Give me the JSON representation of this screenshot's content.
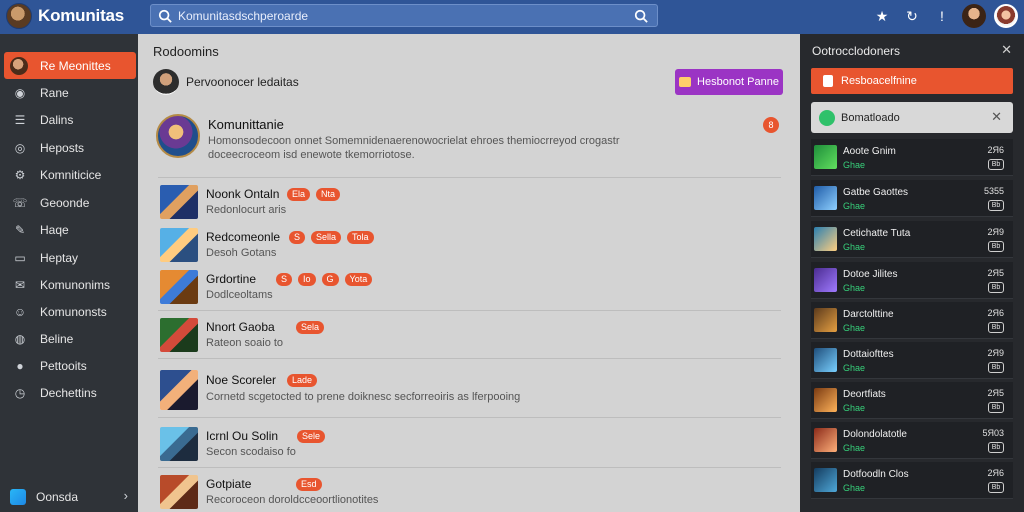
{
  "app": {
    "brand": "Komunitas",
    "accent": "#e8552f",
    "topbar_color": "#2f5597"
  },
  "search": {
    "placeholder": "Komunitasdschperoarde"
  },
  "top_icons": [
    "star-icon",
    "refresh-icon",
    "alert-icon",
    "user-avatar",
    "user-avatar"
  ],
  "sidebar": {
    "items": [
      {
        "label": "Re Meonittes",
        "icon": "avatar-icon",
        "active": true
      },
      {
        "label": "Rane",
        "icon": "compass-icon"
      },
      {
        "label": "Dalins",
        "icon": "list-icon"
      },
      {
        "label": "Heposts",
        "icon": "target-icon"
      },
      {
        "label": "Komniticice",
        "icon": "gear-icon"
      },
      {
        "label": "Geoonde",
        "icon": "phone-icon"
      },
      {
        "label": "Haqe",
        "icon": "pin-icon"
      },
      {
        "label": "Heptay",
        "icon": "window-icon"
      },
      {
        "label": "Komunonims",
        "icon": "mail-icon"
      },
      {
        "label": "Komunonsts",
        "icon": "people-icon"
      },
      {
        "label": "Beline",
        "icon": "globe-icon"
      },
      {
        "label": "Pettooits",
        "icon": "circle-icon"
      },
      {
        "label": "Dechettins",
        "icon": "clock-icon"
      }
    ],
    "footer": {
      "label": "Oonsda",
      "icon": "app-icon"
    }
  },
  "main": {
    "title": "Rodoomins",
    "user": {
      "name": "Pervoonocer ledaitas"
    },
    "action_button": "Hesbonot Panne",
    "community": {
      "name": "Komunittanie",
      "description": "Homonsodecoon onnet Somemnidenaerenowocrielat ehroes themiocrreyod crogastr doceecroceom isd enewote tkemorriotose.",
      "badge": "8"
    },
    "posts": [
      {
        "title": "Noonk Ontaln",
        "subtitle": "Redonlocurt aris",
        "tags": [
          "Ela",
          "Nta"
        ],
        "thumb": "t1"
      },
      {
        "title": "Redcomeonle",
        "subtitle": "Desoh Gotans",
        "tags": [
          "S",
          "Sella",
          "Tola"
        ],
        "thumb": "t2"
      },
      {
        "title": "Grdortine",
        "subtitle": "Dodlceoltams",
        "tags": [
          "S",
          "Io",
          "G",
          "Yota"
        ],
        "thumb": "t3"
      },
      {
        "title": "Nnort Gaoba",
        "subtitle": "Rateon soaio to",
        "tags": [
          "Sela"
        ],
        "thumb": "t4"
      },
      {
        "title": "Noe Scoreler",
        "subtitle": "Cornetd scgetocted to prene doiknesc secforreoiris as lferpooing",
        "tags": [
          "Lade"
        ],
        "thumb": "t5"
      },
      {
        "title": "Icrnl Ou Solin",
        "subtitle": "Secon scodaiso fo",
        "tags": [
          "Sele"
        ],
        "thumb": "t6"
      },
      {
        "title": "Gotpiate",
        "subtitle": "Recoroceon doroldcceoortlionotites",
        "tags": [
          "Esd"
        ],
        "thumb": "t7"
      }
    ]
  },
  "right_panel": {
    "title": "Ootrocclodoners",
    "primary_button": "Resboacelfnine",
    "notice": "Bomatloado",
    "items": [
      {
        "name": "Aoote Gnim",
        "stat": "Ghae",
        "num": "2Я6",
        "badge": "Bb",
        "thumb": "rt1"
      },
      {
        "name": "Gatbe Gaottes",
        "stat": "Ghae",
        "num": "5355",
        "badge": "Bb",
        "thumb": "rt2"
      },
      {
        "name": "Cetichatte Tuta",
        "stat": "Ghae",
        "num": "2Я9",
        "badge": "Bb",
        "thumb": "rt3"
      },
      {
        "name": "Dotoe Jilites",
        "stat": "Ghae",
        "num": "2Я5",
        "badge": "Bb",
        "thumb": "rt4"
      },
      {
        "name": "Darctolttine",
        "stat": "Ghae",
        "num": "2Я6",
        "badge": "Bb",
        "thumb": "rt5"
      },
      {
        "name": "Dottaiofttes",
        "stat": "Ghae",
        "num": "2Я9",
        "badge": "Bb",
        "thumb": "rt6"
      },
      {
        "name": "Deortfiats",
        "stat": "Ghae",
        "num": "2Я5",
        "badge": "Bb",
        "thumb": "rt7"
      },
      {
        "name": "Dolondolatotle",
        "stat": "Ghae",
        "num": "5Я03",
        "badge": "Bb",
        "thumb": "rt8"
      },
      {
        "name": "Dotfoodln Clos",
        "stat": "Ghae",
        "num": "2Я6",
        "badge": "Bb",
        "thumb": "rt9"
      }
    ]
  }
}
